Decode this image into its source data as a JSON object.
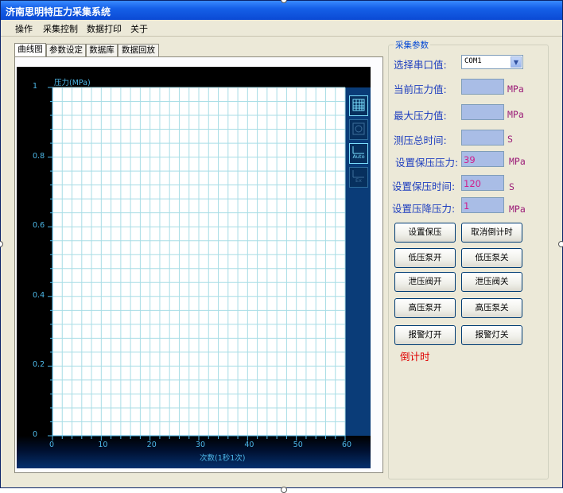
{
  "window": {
    "title": "济南思明特压力采集系统"
  },
  "menu": {
    "items": [
      "操作",
      "采集控制",
      "数据打印",
      "关于"
    ]
  },
  "tabs": [
    "曲线图",
    "参数设定",
    "数据库",
    "数据回放"
  ],
  "chart_data": {
    "type": "line",
    "ylabel": "压力(MPa)",
    "xlabel": "次数(1秒1次)",
    "xlim": [
      0,
      60
    ],
    "ylim": [
      0,
      1
    ],
    "xticks": [
      0,
      10,
      20,
      30,
      40,
      50,
      60
    ],
    "yticks": [
      0,
      0.2,
      0.4,
      0.6,
      0.8,
      1
    ],
    "ytick_labels": [
      "0",
      "0.2",
      "0.4",
      "0.6",
      "0.8",
      "1"
    ],
    "grid": true,
    "series": []
  },
  "params": {
    "group_title": "采集参数",
    "port_label": "选择串口值:",
    "port_value": "COM1",
    "current_label": "当前压力值:",
    "current_value": "",
    "current_unit": "MPa",
    "max_label": "最大压力值:",
    "max_value": "",
    "max_unit": "MPa",
    "time_label": "测压总时间:",
    "time_value": "",
    "time_unit": "S",
    "hold_p_label": "设置保压压力:",
    "hold_p_value": "39",
    "hold_p_unit": "MPa",
    "hold_t_label": "设置保压时间:",
    "hold_t_value": "120",
    "hold_t_unit": "S",
    "drop_label": "设置压降压力:",
    "drop_value": "1",
    "drop_unit": "MPa"
  },
  "buttons": {
    "set_hold": "设置保压",
    "cancel_countdown": "取消倒计时",
    "low_pump_on": "低压泵开",
    "low_pump_off": "低压泵关",
    "relief_on": "泄压阀开",
    "relief_off": "泄压阀关",
    "high_pump_on": "高压泵开",
    "high_pump_off": "高压泵关",
    "alarm_on": "报警灯开",
    "alarm_off": "报警灯关"
  },
  "countdown_label": "倒计时",
  "chart_tools": [
    {
      "icon": "grid-icon",
      "text": ""
    },
    {
      "icon": "zoom-icon",
      "text": ""
    },
    {
      "icon": "auto-scale-icon",
      "text": "Auto"
    },
    {
      "icon": "ex-icon",
      "text": "Ex"
    }
  ]
}
